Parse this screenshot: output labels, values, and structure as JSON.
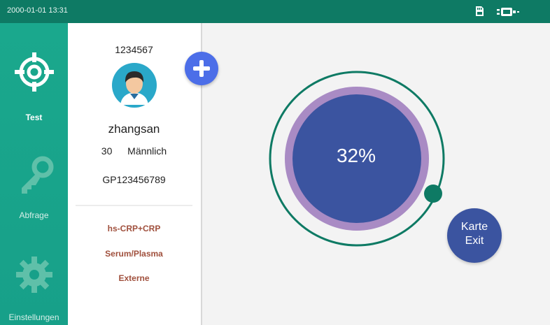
{
  "statusbar": {
    "datetime": "2000-01-01 13:31",
    "sd_icon": "sd-card-icon",
    "battery_icon": "battery-icon"
  },
  "nav": {
    "items": [
      {
        "label": "Test",
        "icon": "crosshair-icon",
        "active": true
      },
      {
        "label": "Abfrage",
        "icon": "key-icon",
        "active": false
      },
      {
        "label": "Einstellungen",
        "icon": "gear-icon",
        "active": false
      }
    ]
  },
  "patient": {
    "id": "1234567",
    "name": "zhangsan",
    "age": "30",
    "gender": "Männlich",
    "code": "GP123456789",
    "avatar_icon": "user-avatar-icon"
  },
  "test": {
    "item": "hs-CRP+CRP",
    "sample": "Serum/Plasma",
    "mode": "Externe"
  },
  "progress": {
    "text": "32%",
    "value": 0.32
  },
  "buttons": {
    "add_icon": "plus-icon",
    "karte_line1": "Karte",
    "karte_line2": "Exit"
  },
  "colors": {
    "accent": "#0e7a64",
    "sidebar": "#17a089",
    "circle_outer": "#a98bc4",
    "circle_inner": "#3b54a0",
    "add_button": "#4c6ee8",
    "test_text": "#a0503d"
  }
}
